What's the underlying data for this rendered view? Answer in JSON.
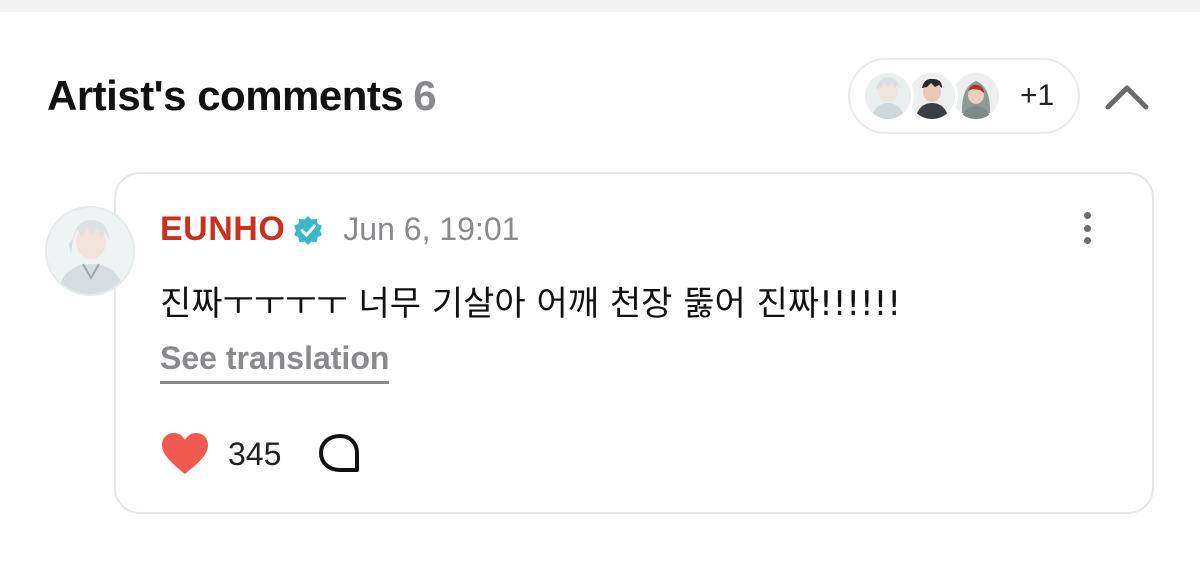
{
  "section": {
    "title": "Artist's comments",
    "count": "6"
  },
  "artists": {
    "more_label": "+1",
    "avatars": [
      "artist-avatar-1",
      "artist-avatar-2",
      "artist-avatar-3"
    ]
  },
  "comment": {
    "author": "EUNHO",
    "timestamp": "Jun 6, 19:01",
    "text": "진짜ㅜㅜㅜㅜ 너무 기살아 어깨 천장 뚫어 진짜!!!!!!",
    "see_translation": "See translation",
    "likes": "345"
  },
  "colors": {
    "author": "#c8301f",
    "heart": "#f05a50",
    "verified": "#3ab7c9",
    "muted": "#8a8a8e"
  },
  "icons": {
    "verified": "verified-badge-icon",
    "heart": "heart-icon",
    "reply": "reply-bubble-icon",
    "more": "more-vertical-icon",
    "collapse": "chevron-up-icon"
  }
}
